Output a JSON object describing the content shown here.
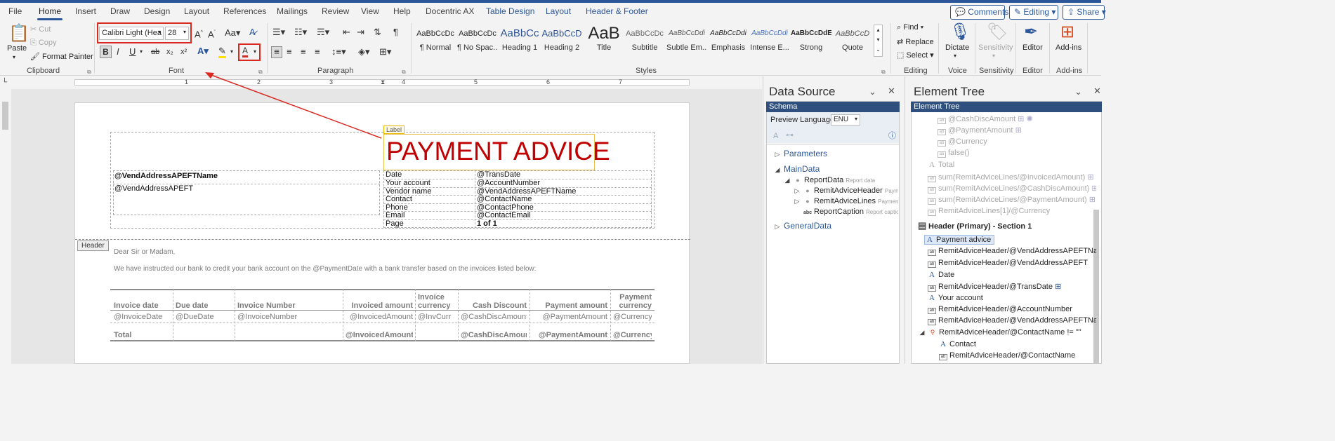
{
  "tabs": [
    {
      "label": "File",
      "name": "tab-file"
    },
    {
      "label": "Home",
      "name": "tab-home",
      "active": true
    },
    {
      "label": "Insert",
      "name": "tab-insert"
    },
    {
      "label": "Draw",
      "name": "tab-draw"
    },
    {
      "label": "Design",
      "name": "tab-design"
    },
    {
      "label": "Layout",
      "name": "tab-layout"
    },
    {
      "label": "References",
      "name": "tab-references"
    },
    {
      "label": "Mailings",
      "name": "tab-mailings"
    },
    {
      "label": "Review",
      "name": "tab-review"
    },
    {
      "label": "View",
      "name": "tab-view"
    },
    {
      "label": "Help",
      "name": "tab-help"
    },
    {
      "label": "Docentric AX",
      "name": "tab-docentric"
    },
    {
      "label": "Table Design",
      "name": "tab-table-design",
      "contextual": true
    },
    {
      "label": "Layout",
      "name": "tab-table-layout",
      "contextual": true
    },
    {
      "label": "Header & Footer",
      "name": "tab-header-footer",
      "contextual": true
    }
  ],
  "top_buttons": {
    "comments": "Comments",
    "editing": "Editing",
    "share": "Share"
  },
  "clipboard": {
    "paste": "Paste",
    "cut": "Cut",
    "copy": "Copy",
    "format_painter": "Format Painter",
    "group": "Clipboard"
  },
  "font": {
    "family": "Calibri Light (Hea",
    "size": "28",
    "group": "Font",
    "bold": "B",
    "italic": "I",
    "underline": "U",
    "strike": "ab",
    "sub": "x₂",
    "sup": "x²",
    "color_letter": "A",
    "case": "Aa"
  },
  "paragraph": {
    "group": "Paragraph"
  },
  "styles": {
    "group": "Styles",
    "items": [
      {
        "sample": "AaBbCcDc",
        "name": "¶ Normal"
      },
      {
        "sample": "AaBbCcDc",
        "name": "¶ No Spac..."
      },
      {
        "sample": "AaBbCc",
        "name": "Heading 1"
      },
      {
        "sample": "AaBbCcD",
        "name": "Heading 2"
      },
      {
        "sample": "AaB",
        "name": "Title"
      },
      {
        "sample": "AaBbCcDc",
        "name": "Subtitle"
      },
      {
        "sample": "AaBbCcDdi",
        "name": "Subtle Em..."
      },
      {
        "sample": "AaBbCcDdi",
        "name": "Emphasis"
      },
      {
        "sample": "AaBbCcDdi",
        "name": "Intense E..."
      },
      {
        "sample": "AaBbCcDdE",
        "name": "Strong"
      },
      {
        "sample": "AaBbCcD",
        "name": "Quote"
      }
    ]
  },
  "editing": {
    "find": "Find",
    "replace": "Replace",
    "select": "Select",
    "group": "Editing"
  },
  "voice": {
    "dictate": "Dictate",
    "group": "Voice"
  },
  "sensitivity": {
    "label": "Sensitivity",
    "group": "Sensitivity"
  },
  "editor": {
    "label": "Editor",
    "group": "Editor"
  },
  "addins": {
    "label": "Add-ins",
    "group": "Add-ins"
  },
  "ruler_numbers": [
    "1",
    "2",
    "3",
    "4",
    "5",
    "6",
    "7"
  ],
  "document": {
    "label_tag": "Label",
    "title": "PAYMENT ADVICE",
    "vend_name": "@VendAddressAPEFTName",
    "vend_address": "@VendAddressAPEFT",
    "info_rows": [
      {
        "label": "Date",
        "value": "@TransDate"
      },
      {
        "label": "Your account",
        "value": "@AccountNumber"
      },
      {
        "label": "Vendor name",
        "value": "@VendAddressAPEFTName"
      },
      {
        "label": "Contact",
        "value": "@ContactName"
      },
      {
        "label": "Phone",
        "value": "@ContactPhone"
      },
      {
        "label": "Email",
        "value": "@ContactEmail"
      },
      {
        "label": "Page",
        "value": "1 of 1"
      }
    ],
    "header_tag": "Header",
    "greeting": "Dear Sir or Madam,",
    "intro": "We have instructed our bank to credit your bank account on the @PaymentDate with a bank transfer based on the invoices listed below:",
    "table": {
      "headers": [
        "Invoice date",
        "Due date",
        "Invoice Number",
        "Invoiced amount",
        "Invoice currency",
        "Cash Discount",
        "Payment amount",
        "Payment currency"
      ],
      "row": [
        "@InvoiceDate",
        "@DueDate",
        "@InvoiceNumber",
        "@InvoicedAmount",
        "@InvCurr",
        "@CashDiscAmount",
        "@PaymentAmount",
        "@Currency"
      ],
      "total": [
        "Total",
        "",
        "",
        "@InvoicedAmount",
        "",
        "@CashDiscAmount",
        "@PaymentAmount",
        "@Currency"
      ]
    }
  },
  "data_source": {
    "title": "Data Source",
    "schema": "Schema",
    "preview_language_label": "Preview Language:",
    "preview_language": "ENU",
    "tree": [
      {
        "label": "Parameters",
        "level": 0,
        "kind": "blue"
      },
      {
        "label": "MainData",
        "level": 0,
        "kind": "blue"
      },
      {
        "label": "ReportData",
        "sub": "Report data",
        "level": 1,
        "kind": "node"
      },
      {
        "label": "RemitAdviceHeader",
        "sub": "Payment",
        "level": 2,
        "kind": "node"
      },
      {
        "label": "RemitAdviceLines",
        "sub": "Payment ad",
        "level": 2,
        "kind": "node"
      },
      {
        "label": "ReportCaption",
        "sub": "Report caption",
        "level": 2,
        "kind": "field"
      },
      {
        "label": "GeneralData",
        "level": 0,
        "kind": "blue"
      }
    ]
  },
  "element_tree": {
    "title": "Element Tree",
    "bar": "Element Tree",
    "items": [
      {
        "label": "@CashDiscAmount",
        "kind": "dimabc",
        "indent": 2
      },
      {
        "label": "@PaymentAmount",
        "kind": "dimabc",
        "indent": 2
      },
      {
        "label": "@Currency",
        "kind": "dimabc",
        "indent": 2
      },
      {
        "label": "false()",
        "kind": "dimabc",
        "indent": 2
      },
      {
        "label": "Total",
        "kind": "dimA",
        "indent": 1
      },
      {
        "label": "sum(RemitAdviceLines/@InvoicedAmount)",
        "kind": "dimabc",
        "indent": 1
      },
      {
        "label": "sum(RemitAdviceLines/@CashDiscAmount)",
        "kind": "dimabc",
        "indent": 1
      },
      {
        "label": "sum(RemitAdviceLines/@PaymentAmount)",
        "kind": "dimabc",
        "indent": 1
      },
      {
        "label": "RemitAdviceLines[1]/@Currency",
        "kind": "dimabc",
        "indent": 1
      },
      {
        "label": "Header (Primary) - Section 1",
        "kind": "section",
        "indent": 0
      },
      {
        "label": "Payment advice",
        "kind": "A",
        "indent": 1,
        "selected": true
      },
      {
        "label": "RemitAdviceHeader/@VendAddressAPEFTName",
        "kind": "abc",
        "indent": 1
      },
      {
        "label": "RemitAdviceHeader/@VendAddressAPEFT",
        "kind": "abc",
        "indent": 1
      },
      {
        "label": "Date",
        "kind": "A",
        "indent": 1
      },
      {
        "label": "RemitAdviceHeader/@TransDate",
        "kind": "abc",
        "indent": 1
      },
      {
        "label": "Your account",
        "kind": "A",
        "indent": 1
      },
      {
        "label": "RemitAdviceHeader/@AccountNumber",
        "kind": "abc",
        "indent": 1
      },
      {
        "label": "RemitAdviceHeader/@VendAddressAPEFTName",
        "kind": "abc",
        "indent": 1
      },
      {
        "label": "RemitAdviceHeader/@ContactName != \"\"",
        "kind": "cond",
        "indent": 1
      },
      {
        "label": "Contact",
        "kind": "A",
        "indent": 2
      },
      {
        "label": "RemitAdviceHeader/@ContactName",
        "kind": "abc",
        "indent": 2
      }
    ]
  },
  "colors": {
    "accent": "#2b579a",
    "title_red": "#c00000",
    "callout": "#d9281f"
  }
}
